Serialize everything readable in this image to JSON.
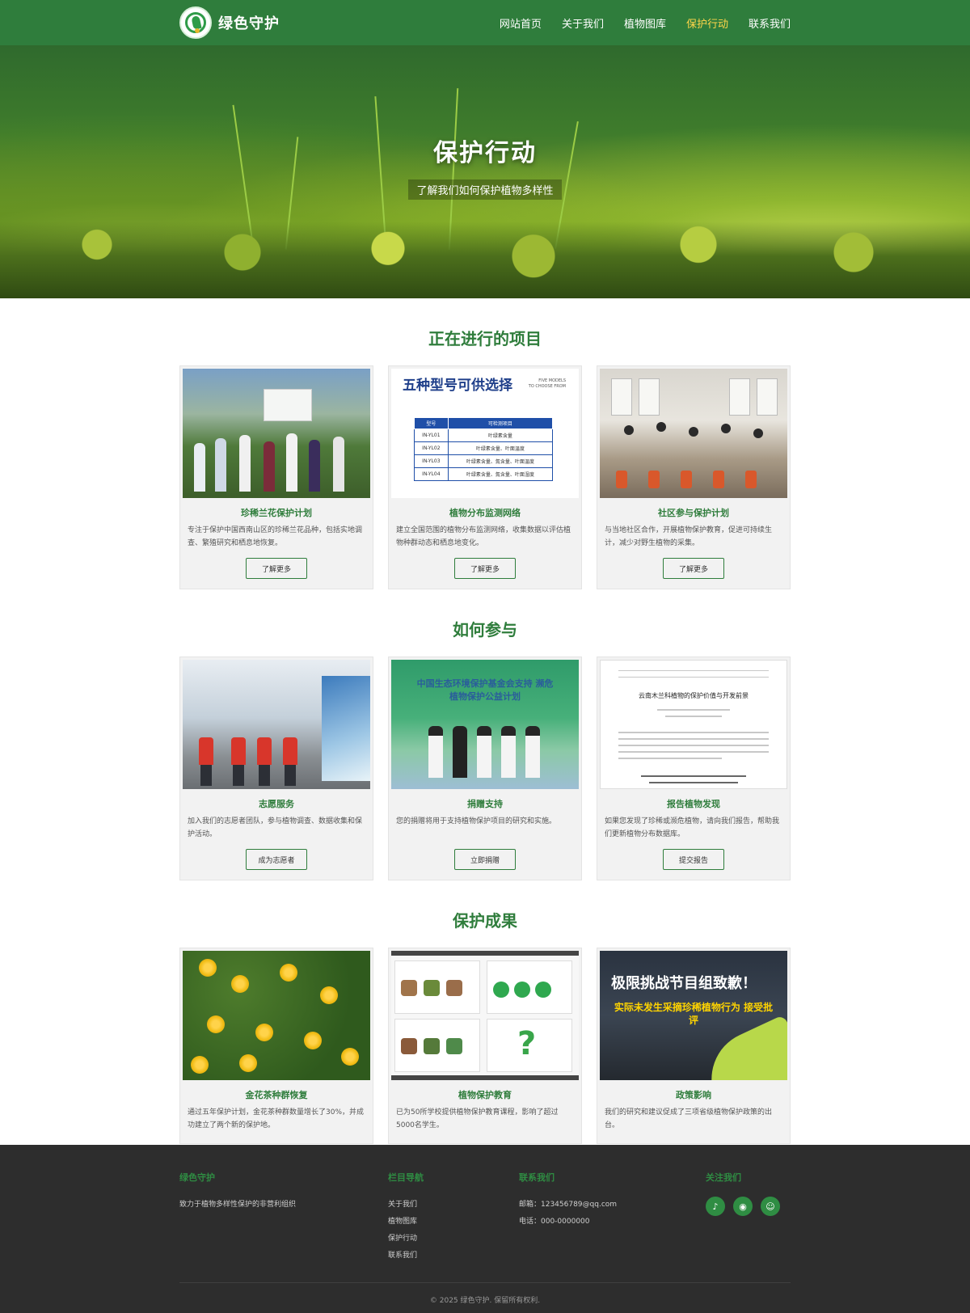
{
  "header": {
    "brand": "绿色守护",
    "nav": [
      "网站首页",
      "关于我们",
      "植物图库",
      "保护行动",
      "联系我们"
    ]
  },
  "hero": {
    "title": "保护行动",
    "subtitle": "了解我们如何保护植物多样性"
  },
  "sections": [
    {
      "title": "正在进行的项目",
      "cards": [
        {
          "title": "珍稀兰花保护计划",
          "desc": "专注于保护中国西南山区的珍稀兰花品种，包括实地调查、繁殖研究和栖息地恢复。",
          "button": "了解更多"
        },
        {
          "title": "植物分布监测网络",
          "desc": "建立全国范围的植物分布监测网络，收集数据以评估植物种群动态和栖息地变化。",
          "button": "了解更多"
        },
        {
          "title": "社区参与保护计划",
          "desc": "与当地社区合作，开展植物保护教育，促进可持续生计，减少对野生植物的采集。",
          "button": "了解更多"
        }
      ]
    },
    {
      "title": "如何参与",
      "cards": [
        {
          "title": "志愿服务",
          "desc": "加入我们的志愿者团队，参与植物调查、数据收集和保护活动。",
          "button": "成为志愿者"
        },
        {
          "title": "捐赠支持",
          "desc": "您的捐赠将用于支持植物保护项目的研究和实施。",
          "button": "立即捐赠"
        },
        {
          "title": "报告植物发现",
          "desc": "如果您发现了珍稀或濒危植物，请向我们报告，帮助我们更新植物分布数据库。",
          "button": "提交报告"
        }
      ]
    },
    {
      "title": "保护成果",
      "cards": [
        {
          "title": "金花茶种群恢复",
          "desc": "通过五年保护计划，金花茶种群数量增长了30%，并成功建立了两个新的保护地。"
        },
        {
          "title": "植物保护教育",
          "desc": "已为50所学校提供植物保护教育课程，影响了超过5000名学生。"
        },
        {
          "title": "政策影响",
          "desc": "我们的研究和建议促成了三项省级植物保护政策的出台。"
        }
      ]
    }
  ],
  "images": {
    "table_title": "五种型号可供选择",
    "table_sub": [
      "FIVE MODELS",
      "TO CHOOSE FROM"
    ],
    "table_head": [
      "型号",
      "可检测项目"
    ],
    "table_rows": [
      [
        "IN-YL01",
        "叶绿素含量"
      ],
      [
        "IN-YL02",
        "叶绿素含量、叶面温度"
      ],
      [
        "IN-YL03",
        "叶绿素含量、氮含量、叶面温度"
      ],
      [
        "IN-YL04",
        "叶绿素含量、氮含量、叶面湿度"
      ]
    ],
    "donate_banner": "中国生态环境保护基金会支持 濒危植物保护公益计划",
    "paper_title": "云南木兰科植物的保护价值与开发前景",
    "policy_line1": "极限挑战节目组致歉！",
    "policy_line2": "实际未发生采摘珍稀植物行为 接受批评"
  },
  "footer": {
    "col1": {
      "title": "绿色守护",
      "text": "致力于植物多样性保护的非营利组织"
    },
    "col2": {
      "title": "栏目导航",
      "links": [
        "关于我们",
        "植物图库",
        "保护行动",
        "联系我们"
      ]
    },
    "col3": {
      "title": "联系我们",
      "email": "邮箱：123456789@qq.com",
      "phone": "电话：000-0000000"
    },
    "col4": {
      "title": "关注我们",
      "icons": [
        "tiktok-icon",
        "weibo-icon",
        "wechat-icon"
      ]
    },
    "copyright": "© 2025 绿色守护. 保留所有权利."
  },
  "colors": {
    "primary": "#2f7d3c",
    "active_nav": "#ffd54a",
    "footer_bg": "#2d2d2d"
  }
}
